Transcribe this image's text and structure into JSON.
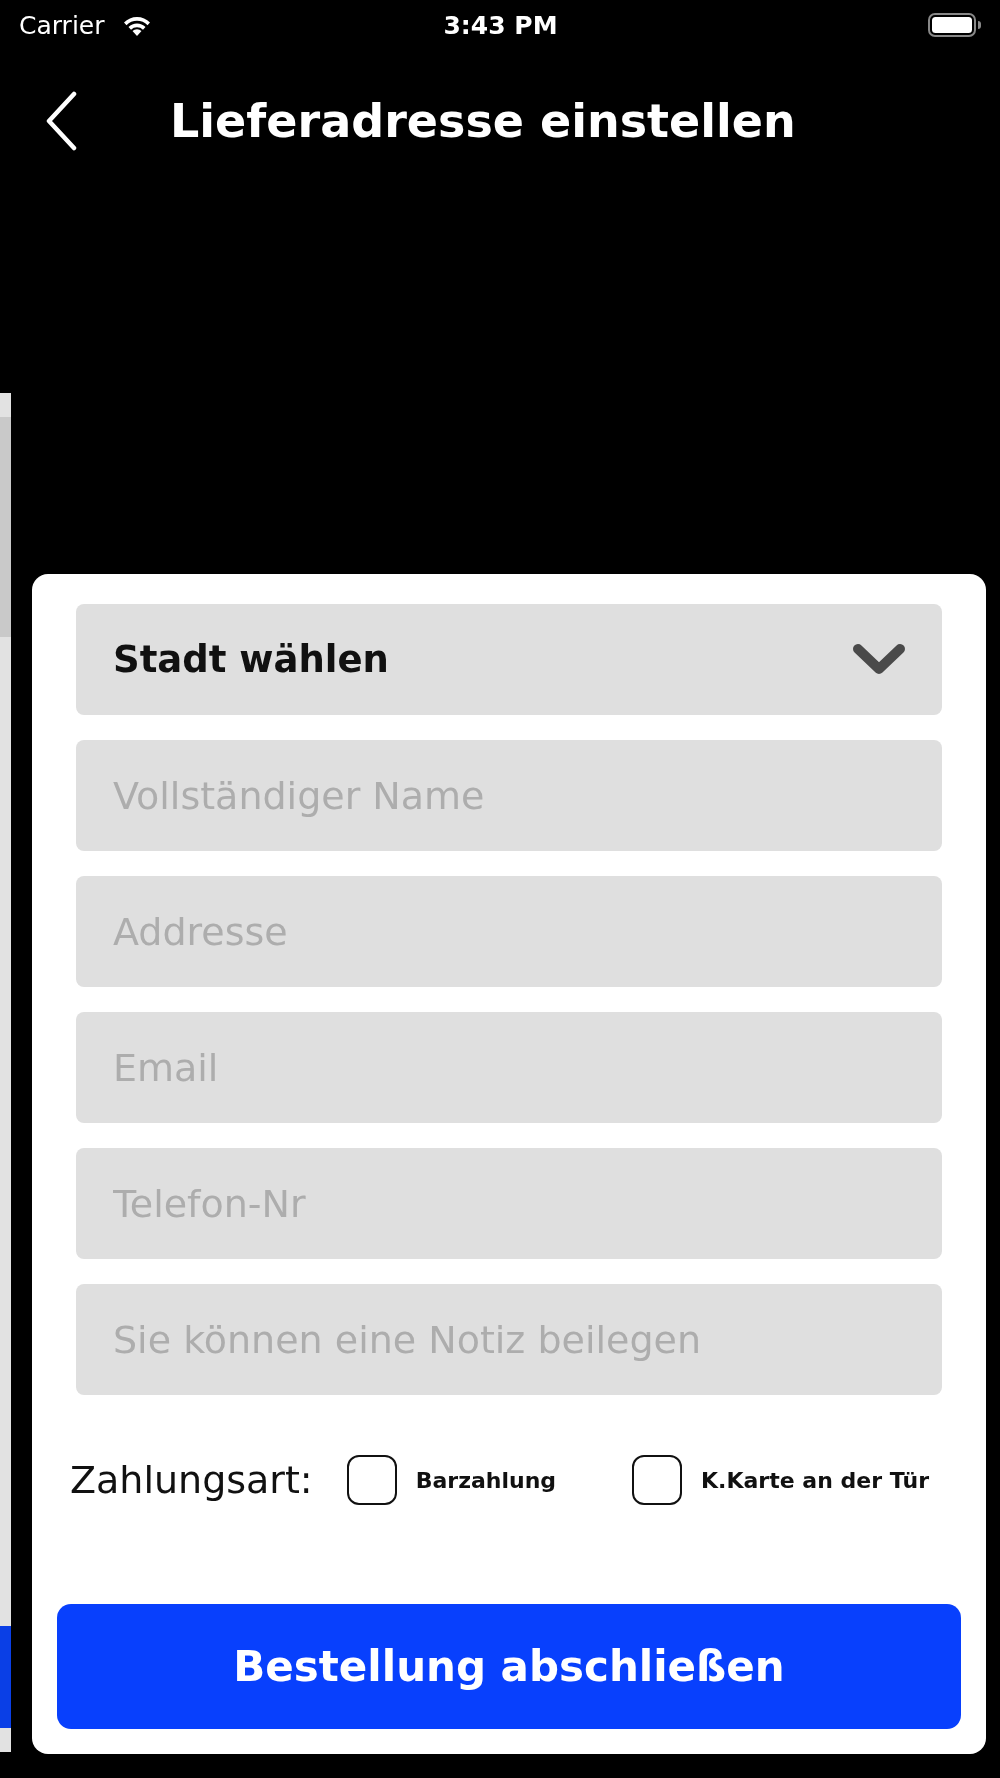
{
  "status_bar": {
    "carrier": "Carrier",
    "time": "3:43 PM"
  },
  "header": {
    "title": "Lieferadresse einstellen"
  },
  "form": {
    "city_select": {
      "value": "Stadt wählen"
    },
    "fields": [
      {
        "placeholder": "Vollständiger Name"
      },
      {
        "placeholder": "Addresse"
      },
      {
        "placeholder": "Email"
      },
      {
        "placeholder": "Telefon-Nr"
      },
      {
        "placeholder": "Sie können eine Notiz beilegen"
      }
    ],
    "payment": {
      "label": "Zahlungsart:",
      "options": [
        {
          "label": "Barzahlung",
          "checked": false
        },
        {
          "label": "K.Karte an der Tür",
          "checked": false
        }
      ]
    },
    "submit_button": "Bestellung abschließen"
  }
}
